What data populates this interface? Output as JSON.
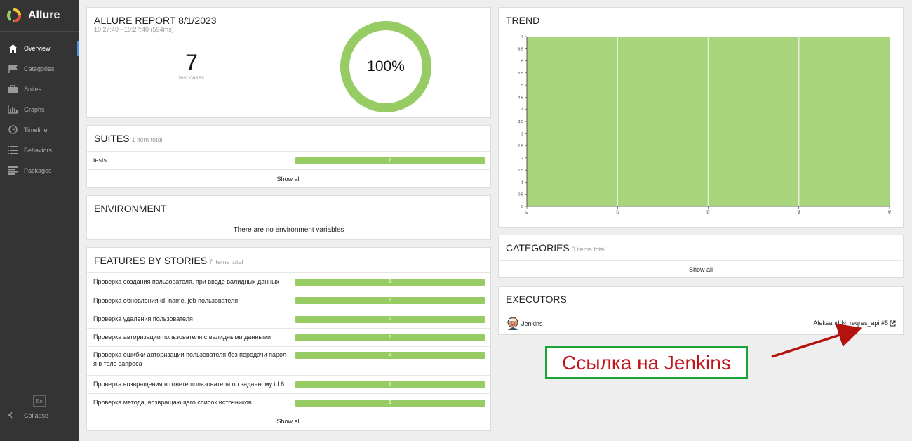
{
  "app": {
    "title": "Allure"
  },
  "sidebar": {
    "items": [
      {
        "label": "Overview",
        "icon": "home-icon"
      },
      {
        "label": "Categories",
        "icon": "flag-icon"
      },
      {
        "label": "Suites",
        "icon": "briefcase-icon"
      },
      {
        "label": "Graphs",
        "icon": "bar-chart-icon"
      },
      {
        "label": "Timeline",
        "icon": "clock-icon"
      },
      {
        "label": "Behaviors",
        "icon": "list-icon"
      },
      {
        "label": "Packages",
        "icon": "align-left-icon"
      }
    ],
    "language": "En",
    "collapse_label": "Collapse"
  },
  "summary": {
    "title": "ALLURE REPORT 8/1/2023",
    "time": "10:27:40 - 10:27:40 (594ms)",
    "count": "7",
    "count_label": "test cases",
    "percent": "100%",
    "pass_fraction": 1.0,
    "pass_color": "#97cc64"
  },
  "suites": {
    "title": "SUITES",
    "subtitle": "1 item total",
    "rows": [
      {
        "name": "tests",
        "value": "7"
      }
    ],
    "show_all": "Show all"
  },
  "environment": {
    "title": "ENVIRONMENT",
    "empty_text": "There are no environment variables"
  },
  "features": {
    "title": "FEATURES BY STORIES",
    "subtitle": "7 items total",
    "rows": [
      {
        "name": "Проверка создания пользователя, при вводе валидных данных",
        "value": "1"
      },
      {
        "name": "Проверка обновления id, name, job пользователя",
        "value": "1"
      },
      {
        "name": "Проверка удаления пользователя",
        "value": "1"
      },
      {
        "name": "Проверка авторизации пользователя с валидными данными",
        "value": "1"
      },
      {
        "name": "Проверка ошибки авторизации пользователя без передачи парол я в теле запроса",
        "value": "1"
      },
      {
        "name": "Проверка возвращения в ответе пользователя по заданному id 6",
        "value": "1"
      },
      {
        "name": "Проверка метода, возвращающего список источников",
        "value": "1"
      }
    ],
    "show_all": "Show all"
  },
  "trend": {
    "title": "TREND"
  },
  "chart_data": {
    "type": "area",
    "x": [
      "#1",
      "#2",
      "#3",
      "#4",
      "#5"
    ],
    "series": [
      {
        "values": [
          7,
          7,
          7,
          7,
          7
        ],
        "color": "#a8d47c"
      }
    ],
    "y_ticks": [
      "0",
      "0.5",
      "1",
      "1.5",
      "2",
      "2.5",
      "3",
      "3.5",
      "4",
      "4.5",
      "5",
      "5.5",
      "6",
      "6.5",
      "7"
    ],
    "ylim": [
      0,
      7
    ],
    "grid": false
  },
  "categories": {
    "title": "CATEGORIES",
    "subtitle": "0 items total",
    "show_all": "Show all"
  },
  "executors": {
    "title": "EXECUTORS",
    "name": "Jenkins",
    "build": "AleksandrN_reqres_api #5"
  },
  "annotation": {
    "text": "Ссылка на Jenkins",
    "border_color": "#1aa436",
    "text_color": "#c0161b",
    "arrow_color": "#b3120e"
  }
}
